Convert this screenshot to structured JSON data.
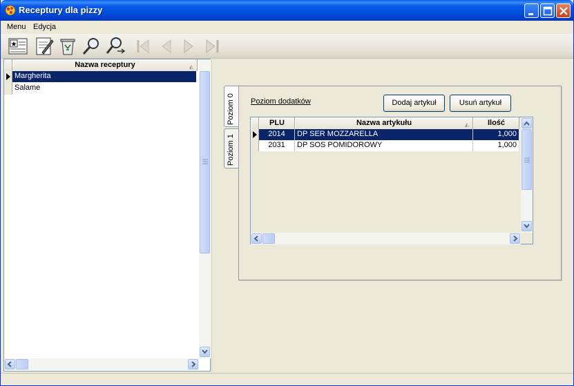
{
  "window": {
    "title": "Receptury dla pizzy"
  },
  "menu": {
    "items": [
      "Menu",
      "Edycja"
    ]
  },
  "toolbar": {
    "tools": [
      "new-record-icon",
      "edit-record-icon",
      "delete-record-icon",
      "search-icon",
      "search-next-icon",
      "first-record-icon",
      "prev-record-icon",
      "next-record-icon",
      "last-record-icon"
    ]
  },
  "recipes_grid": {
    "header": "Nazwa receptury",
    "rows": [
      "Margherita",
      "Salame"
    ],
    "selected_index": 0
  },
  "tabs": {
    "items": [
      "Poziom 0",
      "Poziom 1"
    ],
    "active_index": 0
  },
  "panel": {
    "level_label": "Poziom dodatków",
    "add_button": "Dodaj artykuł",
    "remove_button": "Usuń artykuł"
  },
  "articles_grid": {
    "columns": [
      "PLU",
      "Nazwa artykułu",
      "Ilość"
    ],
    "rows": [
      {
        "plu": "2014",
        "name": "DP SER MOZZARELLA",
        "qty": "1,000"
      },
      {
        "plu": "2031",
        "name": "DP SOS POMIDOROWY",
        "qty": "1,000"
      }
    ],
    "selected_index": 0
  },
  "colors": {
    "selection": "#0a246a",
    "titlebar": "#0054e3",
    "window_bg": "#ece9d8"
  }
}
